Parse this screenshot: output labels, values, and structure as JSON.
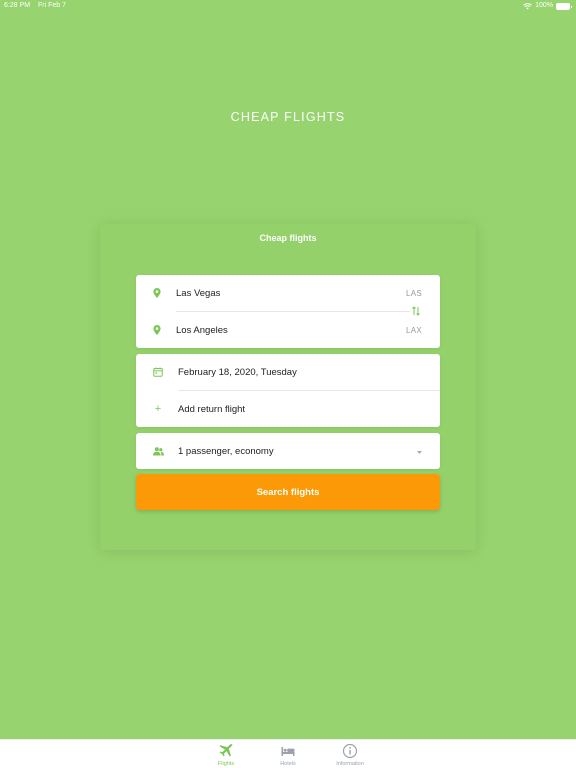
{
  "status_bar": {
    "time": "6:28 PM",
    "date": "Fri Feb 7",
    "battery": "100%"
  },
  "app_title": "CHEAP FLIGHTS",
  "panel_title": "Cheap flights",
  "route": {
    "origin": {
      "city": "Las Vegas",
      "code": "LAS",
      "icon": "location-pin-icon"
    },
    "destination": {
      "city": "Los Angeles",
      "code": "LAX",
      "icon": "location-pin-icon"
    },
    "swap_icon": "swap-arrows-icon"
  },
  "dates": {
    "depart": "February 18, 2020, Tuesday",
    "return_label": "Add return flight"
  },
  "passengers": {
    "value": "1 passenger, economy",
    "icon": "people-icon"
  },
  "search_button": "Search flights",
  "tabs": [
    {
      "label": "Flights",
      "icon": "airplane-icon",
      "active": true
    },
    {
      "label": "Hotels",
      "icon": "bed-icon",
      "active": false
    },
    {
      "label": "Information",
      "icon": "info-icon",
      "active": false
    }
  ],
  "colors": {
    "background": "#97d36e",
    "accent_green": "#7cc656",
    "search_button": "#fb9a06"
  }
}
